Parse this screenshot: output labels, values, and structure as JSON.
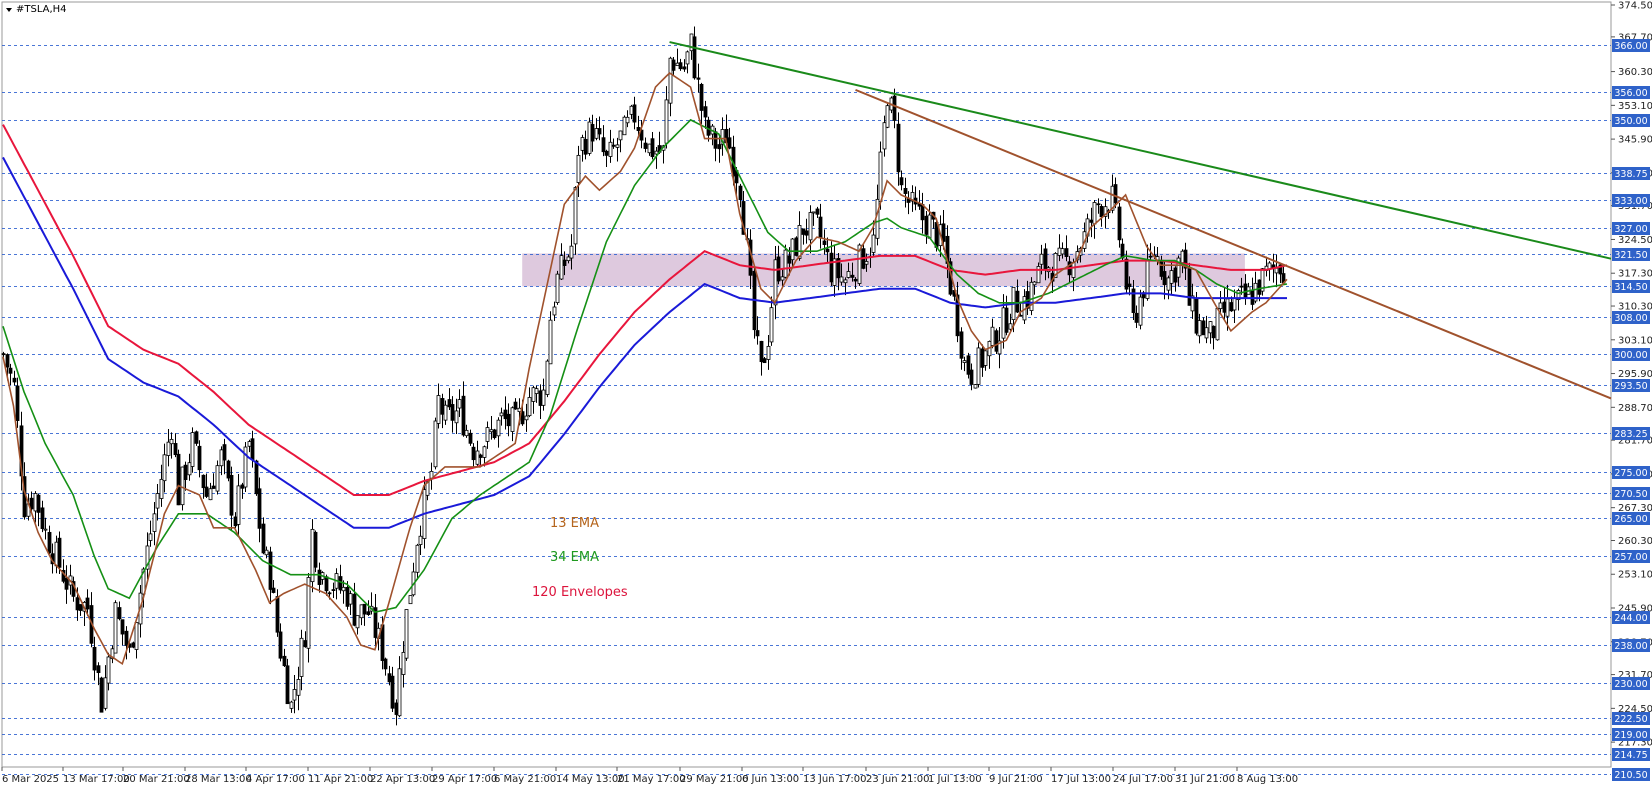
{
  "chart_data": {
    "type": "candlestick",
    "title": "#TSLA,H4",
    "symbol": "#TSLA",
    "timeframe": "H4",
    "ylim": [
      210.5,
      374.5
    ],
    "grid": false,
    "y_ticks": [
      "374.50",
      "367.70",
      "360.30",
      "353.10",
      "345.90",
      "338.70",
      "331.70",
      "324.50",
      "317.30",
      "310.30",
      "303.10",
      "295.90",
      "288.70",
      "281.70",
      "274.50",
      "267.30",
      "260.30",
      "253.10",
      "245.90",
      "238.70",
      "231.70",
      "224.50",
      "217.30"
    ],
    "x_ticks": [
      "6 Mar 2025",
      "13 Mar 17:00",
      "20 Mar 21:00",
      "28 Mar 13:00",
      "4 Apr 17:00",
      "11 Apr 21:00",
      "22 Apr 13:00",
      "29 Apr 17:00",
      "6 May 21:00",
      "14 May 13:00",
      "21 May 17:00",
      "29 May 21:00",
      "6 Jun 13:00",
      "13 Jun 17:00",
      "23 Jun 21:00",
      "1 Jul 13:00",
      "9 Jul 21:00",
      "17 Jul 13:00",
      "24 Jul 17:00",
      "31 Jul 21:00",
      "8 Aug 13:00"
    ],
    "horizontal_levels": [
      "366.00",
      "356.00",
      "350.00",
      "338.75",
      "333.00",
      "327.00",
      "321.50",
      "314.50",
      "308.00",
      "300.00",
      "293.50",
      "283.25",
      "275.00",
      "270.50",
      "265.00",
      "257.00",
      "244.00",
      "238.00",
      "230.00",
      "222.50",
      "219.00",
      "214.75",
      "210.50"
    ],
    "zone": {
      "from": 314.5,
      "to": 321.5,
      "color": "#d8bfd8"
    },
    "legend": [
      {
        "label": "13 EMA",
        "color": "#b5651d"
      },
      {
        "label": "34 EMA",
        "color": "#1f9a1f"
      },
      {
        "label": "120 Envelopes",
        "color": "#dc143c"
      }
    ],
    "colors": {
      "ema13": "#a0522d",
      "ema34": "#159015",
      "env_upper": "#e8163c",
      "env_lower": "#1a1ad8",
      "trend_green": "#1a8a1a",
      "trend_brown": "#a0522d",
      "level_line": "#2b5fcf",
      "label_bg": "#2f62c9"
    },
    "trendlines": [
      {
        "name": "green",
        "from": {
          "x": "26 May",
          "y": 366.6
        },
        "to": {
          "x": "chart right edge",
          "y": 320.4
        }
      },
      {
        "name": "brown",
        "from": {
          "x": "23 Jun",
          "y": 356.4
        },
        "to": {
          "x": "chart right edge",
          "y": 290.6
        }
      }
    ],
    "series": [
      {
        "name": "13 EMA",
        "values": [
          [
            0,
            299.5
          ],
          [
            3,
            289
          ],
          [
            6,
            271
          ],
          [
            10,
            262
          ],
          [
            14,
            256
          ],
          [
            20,
            251
          ],
          [
            26,
            241.5
          ],
          [
            30,
            236
          ],
          [
            34,
            234
          ],
          [
            40,
            248
          ],
          [
            46,
            266
          ],
          [
            50,
            272
          ],
          [
            56,
            270
          ],
          [
            60,
            263
          ],
          [
            66,
            263
          ],
          [
            72,
            254
          ],
          [
            76,
            247
          ],
          [
            80,
            249
          ],
          [
            86,
            251
          ],
          [
            92,
            249
          ],
          [
            98,
            244
          ],
          [
            102,
            238
          ],
          [
            106,
            237
          ],
          [
            110,
            247
          ],
          [
            116,
            263
          ],
          [
            120,
            272
          ],
          [
            126,
            276
          ],
          [
            130,
            276
          ],
          [
            136,
            276
          ],
          [
            140,
            278
          ],
          [
            146,
            281
          ],
          [
            150,
            297
          ],
          [
            156,
            318
          ],
          [
            160,
            332
          ],
          [
            166,
            338
          ],
          [
            170,
            335
          ],
          [
            176,
            339
          ],
          [
            180,
            344
          ],
          [
            186,
            357
          ],
          [
            190,
            360
          ],
          [
            196,
            357
          ],
          [
            200,
            346
          ],
          [
            206,
            346
          ],
          [
            210,
            330
          ],
          [
            216,
            314
          ],
          [
            220,
            311
          ],
          [
            226,
            320
          ],
          [
            232,
            325
          ],
          [
            238,
            324
          ],
          [
            244,
            322
          ],
          [
            248,
            327
          ],
          [
            252,
            337
          ],
          [
            256,
            334
          ],
          [
            262,
            332
          ],
          [
            266,
            329
          ],
          [
            272,
            312
          ],
          [
            276,
            305
          ],
          [
            280,
            301
          ],
          [
            286,
            303
          ],
          [
            290,
            309
          ],
          [
            296,
            312
          ],
          [
            300,
            317
          ],
          [
            306,
            320
          ],
          [
            310,
            327
          ],
          [
            316,
            331
          ],
          [
            320,
            334
          ],
          [
            326,
            323
          ],
          [
            330,
            319
          ],
          [
            336,
            319
          ],
          [
            340,
            318
          ],
          [
            346,
            310
          ],
          [
            350,
            305
          ],
          [
            356,
            309
          ],
          [
            360,
            311
          ],
          [
            366,
            316
          ]
        ]
      },
      {
        "name": "34 EMA",
        "values": [
          [
            0,
            306
          ],
          [
            6,
            292
          ],
          [
            12,
            281
          ],
          [
            20,
            270
          ],
          [
            26,
            257
          ],
          [
            30,
            250
          ],
          [
            36,
            248
          ],
          [
            44,
            259
          ],
          [
            50,
            266
          ],
          [
            58,
            266
          ],
          [
            66,
            262
          ],
          [
            74,
            256
          ],
          [
            82,
            253
          ],
          [
            90,
            253
          ],
          [
            98,
            251
          ],
          [
            106,
            245
          ],
          [
            112,
            246
          ],
          [
            120,
            254
          ],
          [
            128,
            265
          ],
          [
            136,
            270
          ],
          [
            144,
            274
          ],
          [
            150,
            277
          ],
          [
            156,
            287
          ],
          [
            164,
            306
          ],
          [
            172,
            324
          ],
          [
            180,
            336
          ],
          [
            188,
            344
          ],
          [
            196,
            350
          ],
          [
            204,
            347
          ],
          [
            210,
            338
          ],
          [
            218,
            326
          ],
          [
            224,
            322
          ],
          [
            232,
            322
          ],
          [
            240,
            324
          ],
          [
            248,
            328
          ],
          [
            252,
            329
          ],
          [
            256,
            327
          ],
          [
            264,
            325
          ],
          [
            272,
            317
          ],
          [
            278,
            313
          ],
          [
            284,
            311
          ],
          [
            290,
            311
          ],
          [
            298,
            313
          ],
          [
            306,
            316
          ],
          [
            314,
            319
          ],
          [
            320,
            321
          ],
          [
            328,
            320
          ],
          [
            334,
            320
          ],
          [
            340,
            318
          ],
          [
            346,
            315
          ],
          [
            352,
            313
          ],
          [
            358,
            314
          ],
          [
            366,
            315
          ]
        ]
      },
      {
        "name": "120 Envelopes upper",
        "values": [
          [
            0,
            349
          ],
          [
            10,
            335
          ],
          [
            20,
            321
          ],
          [
            30,
            306
          ],
          [
            40,
            301
          ],
          [
            50,
            298
          ],
          [
            60,
            292
          ],
          [
            70,
            285
          ],
          [
            80,
            280
          ],
          [
            90,
            275
          ],
          [
            100,
            270
          ],
          [
            110,
            270
          ],
          [
            120,
            273
          ],
          [
            130,
            275
          ],
          [
            140,
            277
          ],
          [
            150,
            281
          ],
          [
            160,
            290
          ],
          [
            170,
            300
          ],
          [
            180,
            309
          ],
          [
            190,
            316
          ],
          [
            200,
            322
          ],
          [
            210,
            319
          ],
          [
            220,
            318
          ],
          [
            230,
            319
          ],
          [
            240,
            320
          ],
          [
            250,
            321
          ],
          [
            260,
            321
          ],
          [
            270,
            318
          ],
          [
            280,
            317
          ],
          [
            290,
            318
          ],
          [
            300,
            318
          ],
          [
            310,
            319
          ],
          [
            320,
            320
          ],
          [
            330,
            320
          ],
          [
            340,
            319
          ],
          [
            350,
            318
          ],
          [
            360,
            318
          ],
          [
            366,
            319
          ]
        ]
      },
      {
        "name": "120 Envelopes lower",
        "values": [
          [
            0,
            342
          ],
          [
            10,
            328
          ],
          [
            20,
            314
          ],
          [
            30,
            299
          ],
          [
            40,
            294
          ],
          [
            50,
            291
          ],
          [
            60,
            285
          ],
          [
            70,
            278
          ],
          [
            80,
            273
          ],
          [
            90,
            268
          ],
          [
            100,
            263
          ],
          [
            110,
            263
          ],
          [
            120,
            266
          ],
          [
            130,
            268
          ],
          [
            140,
            270
          ],
          [
            150,
            274
          ],
          [
            160,
            283
          ],
          [
            170,
            293
          ],
          [
            180,
            302
          ],
          [
            190,
            309
          ],
          [
            200,
            315
          ],
          [
            210,
            312
          ],
          [
            220,
            311
          ],
          [
            230,
            312
          ],
          [
            240,
            313
          ],
          [
            250,
            314
          ],
          [
            260,
            314
          ],
          [
            270,
            311
          ],
          [
            280,
            310
          ],
          [
            290,
            311
          ],
          [
            300,
            311
          ],
          [
            310,
            312
          ],
          [
            320,
            313
          ],
          [
            330,
            313
          ],
          [
            340,
            312
          ],
          [
            350,
            312
          ],
          [
            360,
            312
          ],
          [
            366,
            312
          ]
        ]
      }
    ],
    "price_path": [
      [
        0,
        300
      ],
      [
        3,
        293
      ],
      [
        6,
        268
      ],
      [
        9,
        270
      ],
      [
        12,
        262
      ],
      [
        16,
        255
      ],
      [
        20,
        248
      ],
      [
        24,
        246
      ],
      [
        28,
        226
      ],
      [
        32,
        245
      ],
      [
        36,
        236
      ],
      [
        40,
        254
      ],
      [
        44,
        270
      ],
      [
        48,
        285
      ],
      [
        50,
        270
      ],
      [
        54,
        281
      ],
      [
        58,
        270
      ],
      [
        62,
        278
      ],
      [
        66,
        265
      ],
      [
        70,
        281
      ],
      [
        74,
        258
      ],
      [
        76,
        253
      ],
      [
        78,
        241
      ],
      [
        82,
        225
      ],
      [
        86,
        241
      ],
      [
        88,
        262
      ],
      [
        90,
        254
      ],
      [
        94,
        251
      ],
      [
        98,
        249
      ],
      [
        100,
        245
      ],
      [
        104,
        245
      ],
      [
        108,
        237
      ],
      [
        112,
        225
      ],
      [
        114,
        239
      ],
      [
        118,
        261
      ],
      [
        122,
        275
      ],
      [
        124,
        290
      ],
      [
        126,
        286
      ],
      [
        130,
        288
      ],
      [
        134,
        280
      ],
      [
        138,
        282
      ],
      [
        142,
        286
      ],
      [
        146,
        285
      ],
      [
        150,
        291
      ],
      [
        154,
        292
      ],
      [
        156,
        308
      ],
      [
        158,
        316
      ],
      [
        162,
        323
      ],
      [
        164,
        344
      ],
      [
        168,
        348
      ],
      [
        172,
        341
      ],
      [
        176,
        346
      ],
      [
        180,
        351
      ],
      [
        184,
        344
      ],
      [
        188,
        343
      ],
      [
        190,
        363
      ],
      [
        194,
        361
      ],
      [
        196,
        366
      ],
      [
        200,
        348
      ],
      [
        204,
        344
      ],
      [
        206,
        347
      ],
      [
        210,
        336
      ],
      [
        212,
        322
      ],
      [
        214,
        305
      ],
      [
        216,
        296
      ],
      [
        218,
        304
      ],
      [
        220,
        318
      ],
      [
        224,
        320
      ],
      [
        228,
        327
      ],
      [
        232,
        327
      ],
      [
        236,
        318
      ],
      [
        240,
        316
      ],
      [
        244,
        320
      ],
      [
        248,
        324
      ],
      [
        250,
        340
      ],
      [
        252,
        356
      ],
      [
        254,
        348
      ],
      [
        256,
        335
      ],
      [
        260,
        330
      ],
      [
        264,
        328
      ],
      [
        268,
        323
      ],
      [
        272,
        307
      ],
      [
        274,
        298
      ],
      [
        276,
        296
      ],
      [
        280,
        300
      ],
      [
        284,
        305
      ],
      [
        288,
        311
      ],
      [
        292,
        312
      ],
      [
        296,
        319
      ],
      [
        300,
        319
      ],
      [
        304,
        320
      ],
      [
        308,
        325
      ],
      [
        312,
        332
      ],
      [
        316,
        333
      ],
      [
        318,
        325
      ],
      [
        320,
        315
      ],
      [
        322,
        307
      ],
      [
        324,
        312
      ],
      [
        328,
        322
      ],
      [
        332,
        316
      ],
      [
        336,
        321
      ],
      [
        338,
        311
      ],
      [
        340,
        307
      ],
      [
        344,
        304
      ],
      [
        348,
        309
      ],
      [
        352,
        311
      ],
      [
        356,
        313
      ],
      [
        360,
        317
      ],
      [
        364,
        319
      ],
      [
        366,
        318
      ]
    ]
  }
}
